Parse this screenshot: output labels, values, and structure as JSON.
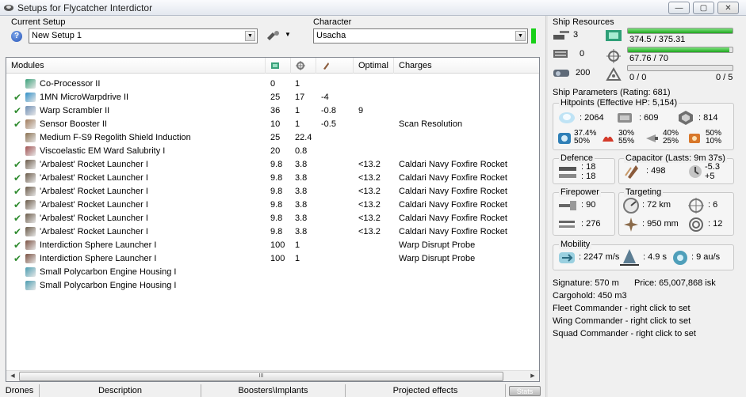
{
  "window": {
    "title": "Setups for Flycatcher Interdictor",
    "minimize": "—",
    "maximize": "▢",
    "close": "✕"
  },
  "setup": {
    "label": "Current Setup",
    "value": "New Setup 1",
    "help": "?"
  },
  "character": {
    "label": "Character",
    "value": "Usacha"
  },
  "modules": {
    "columns": {
      "name": "Modules",
      "cpu_icon": "cpu-icon",
      "power_icon": "powergrid-icon",
      "cap_icon": "capacitor-icon",
      "optimal": "Optimal",
      "charges": "Charges"
    },
    "rows": [
      {
        "active": false,
        "icon": "coprocessor-icon",
        "color": "#3aa17a",
        "name": "Co-Processor II",
        "cpu": "0",
        "pg": "1",
        "cap": "",
        "optimal": "",
        "charge": ""
      },
      {
        "active": true,
        "icon": "microwarpdrive-icon",
        "color": "#2f8fc7",
        "name": "1MN MicroWarpdrive II",
        "cpu": "25",
        "pg": "17",
        "cap": "-4",
        "optimal": "",
        "charge": ""
      },
      {
        "active": true,
        "icon": "warp-scrambler-icon",
        "color": "#6f8fb5",
        "name": "Warp Scrambler II",
        "cpu": "36",
        "pg": "1",
        "cap": "-0.8",
        "optimal": "9",
        "charge": ""
      },
      {
        "active": true,
        "icon": "sensor-booster-icon",
        "color": "#a07a5a",
        "name": "Sensor Booster II",
        "cpu": "10",
        "pg": "1",
        "cap": "-0.5",
        "optimal": "",
        "charge": "Scan Resolution"
      },
      {
        "active": false,
        "icon": "shield-rig-icon",
        "color": "#8a7050",
        "name": "Medium F-S9 Regolith Shield Induction",
        "cpu": "25",
        "pg": "22.4",
        "cap": "",
        "optimal": "",
        "charge": ""
      },
      {
        "active": false,
        "icon": "ward-icon",
        "color": "#a05050",
        "name": "Viscoelastic EM Ward Salubrity I",
        "cpu": "20",
        "pg": "0.8",
        "cap": "",
        "optimal": "",
        "charge": ""
      },
      {
        "active": true,
        "icon": "rocket-launcher-icon",
        "color": "#6a5a48",
        "name": "'Arbalest' Rocket Launcher I",
        "cpu": "9.8",
        "pg": "3.8",
        "cap": "",
        "optimal": "<13.2",
        "charge": "Caldari Navy Foxfire Rocket"
      },
      {
        "active": true,
        "icon": "rocket-launcher-icon",
        "color": "#6a5a48",
        "name": "'Arbalest' Rocket Launcher I",
        "cpu": "9.8",
        "pg": "3.8",
        "cap": "",
        "optimal": "<13.2",
        "charge": "Caldari Navy Foxfire Rocket"
      },
      {
        "active": true,
        "icon": "rocket-launcher-icon",
        "color": "#6a5a48",
        "name": "'Arbalest' Rocket Launcher I",
        "cpu": "9.8",
        "pg": "3.8",
        "cap": "",
        "optimal": "<13.2",
        "charge": "Caldari Navy Foxfire Rocket"
      },
      {
        "active": true,
        "icon": "rocket-launcher-icon",
        "color": "#6a5a48",
        "name": "'Arbalest' Rocket Launcher I",
        "cpu": "9.8",
        "pg": "3.8",
        "cap": "",
        "optimal": "<13.2",
        "charge": "Caldari Navy Foxfire Rocket"
      },
      {
        "active": true,
        "icon": "rocket-launcher-icon",
        "color": "#6a5a48",
        "name": "'Arbalest' Rocket Launcher I",
        "cpu": "9.8",
        "pg": "3.8",
        "cap": "",
        "optimal": "<13.2",
        "charge": "Caldari Navy Foxfire Rocket"
      },
      {
        "active": true,
        "icon": "rocket-launcher-icon",
        "color": "#6a5a48",
        "name": "'Arbalest' Rocket Launcher I",
        "cpu": "9.8",
        "pg": "3.8",
        "cap": "",
        "optimal": "<13.2",
        "charge": "Caldari Navy Foxfire Rocket"
      },
      {
        "active": true,
        "icon": "interdiction-launcher-icon",
        "color": "#7a5040",
        "name": "Interdiction Sphere Launcher I",
        "cpu": "100",
        "pg": "1",
        "cap": "",
        "optimal": "",
        "charge": "Warp Disrupt Probe"
      },
      {
        "active": true,
        "icon": "interdiction-launcher-icon",
        "color": "#7a5040",
        "name": "Interdiction Sphere Launcher I",
        "cpu": "100",
        "pg": "1",
        "cap": "",
        "optimal": "",
        "charge": "Warp Disrupt Probe"
      },
      {
        "active": false,
        "icon": "engine-rig-icon",
        "color": "#4a9cb0",
        "name": "Small Polycarbon Engine Housing I",
        "cpu": "",
        "pg": "",
        "cap": "",
        "optimal": "",
        "charge": ""
      },
      {
        "active": false,
        "icon": "engine-rig-icon",
        "color": "#4a9cb0",
        "name": "Small Polycarbon Engine Housing I",
        "cpu": "",
        "pg": "",
        "cap": "",
        "optimal": "",
        "charge": ""
      }
    ],
    "scroll_grip": "III"
  },
  "tabs": [
    "Drones",
    "Description",
    "Boosters\\Implants",
    "Projected effects"
  ],
  "status_button": "Stats",
  "resources": {
    "title": "Ship Resources",
    "turrets": "3",
    "launchers_left": "0",
    "drone_bay": "200",
    "cpu": "374.5 / 375.31",
    "cpu_fraction": 0.998,
    "powergrid": "67.76 / 70",
    "powergrid_fraction": 0.968,
    "calibration": "0 / 0",
    "drones": "0 / 5",
    "calibration_fraction": 0
  },
  "parameters": {
    "title": "Ship Parameters (Rating: 681)",
    "hitpoints_title": "Hitpoints (Effective HP: 5,154)",
    "shield_hp": ": 2064",
    "armor_hp": ": 609",
    "structure_hp": ": 814",
    "resists": [
      {
        "top": "37.4%",
        "bottom": "50%"
      },
      {
        "top": "30%",
        "bottom": "55%"
      },
      {
        "top": "40%",
        "bottom": "25%"
      },
      {
        "top": "50%",
        "bottom": "10%"
      }
    ],
    "defence_title": "Defence",
    "defence_top": ": 18",
    "defence_bottom": ": 18",
    "capacitor_title": "Capacitor (Lasts: 9m 37s)",
    "capacitor_amount": ": 498",
    "capacitor_delta_top": "-5.3",
    "capacitor_delta_bottom": "+5",
    "firepower_title": "Firepower",
    "firepower_dps": ": 90",
    "firepower_volley": ": 276",
    "targeting_title": "Targeting",
    "target_range": ": 72 km",
    "max_targets": ": 6",
    "scan_res": ": 950 mm",
    "sensor_strength": ": 12",
    "mobility_title": "Mobility",
    "speed": ": 2247 m/s",
    "align": ": 4.9 s",
    "warp": ": 9 au/s"
  },
  "info": {
    "signature": "Signature: 570 m",
    "price": "Price: 65,007,868 isk",
    "cargohold": "Cargohold: 450 m3",
    "fleet": "Fleet Commander - right click to set",
    "wing": "Wing Commander - right click to set",
    "squad": "Squad Commander - right click to set"
  }
}
